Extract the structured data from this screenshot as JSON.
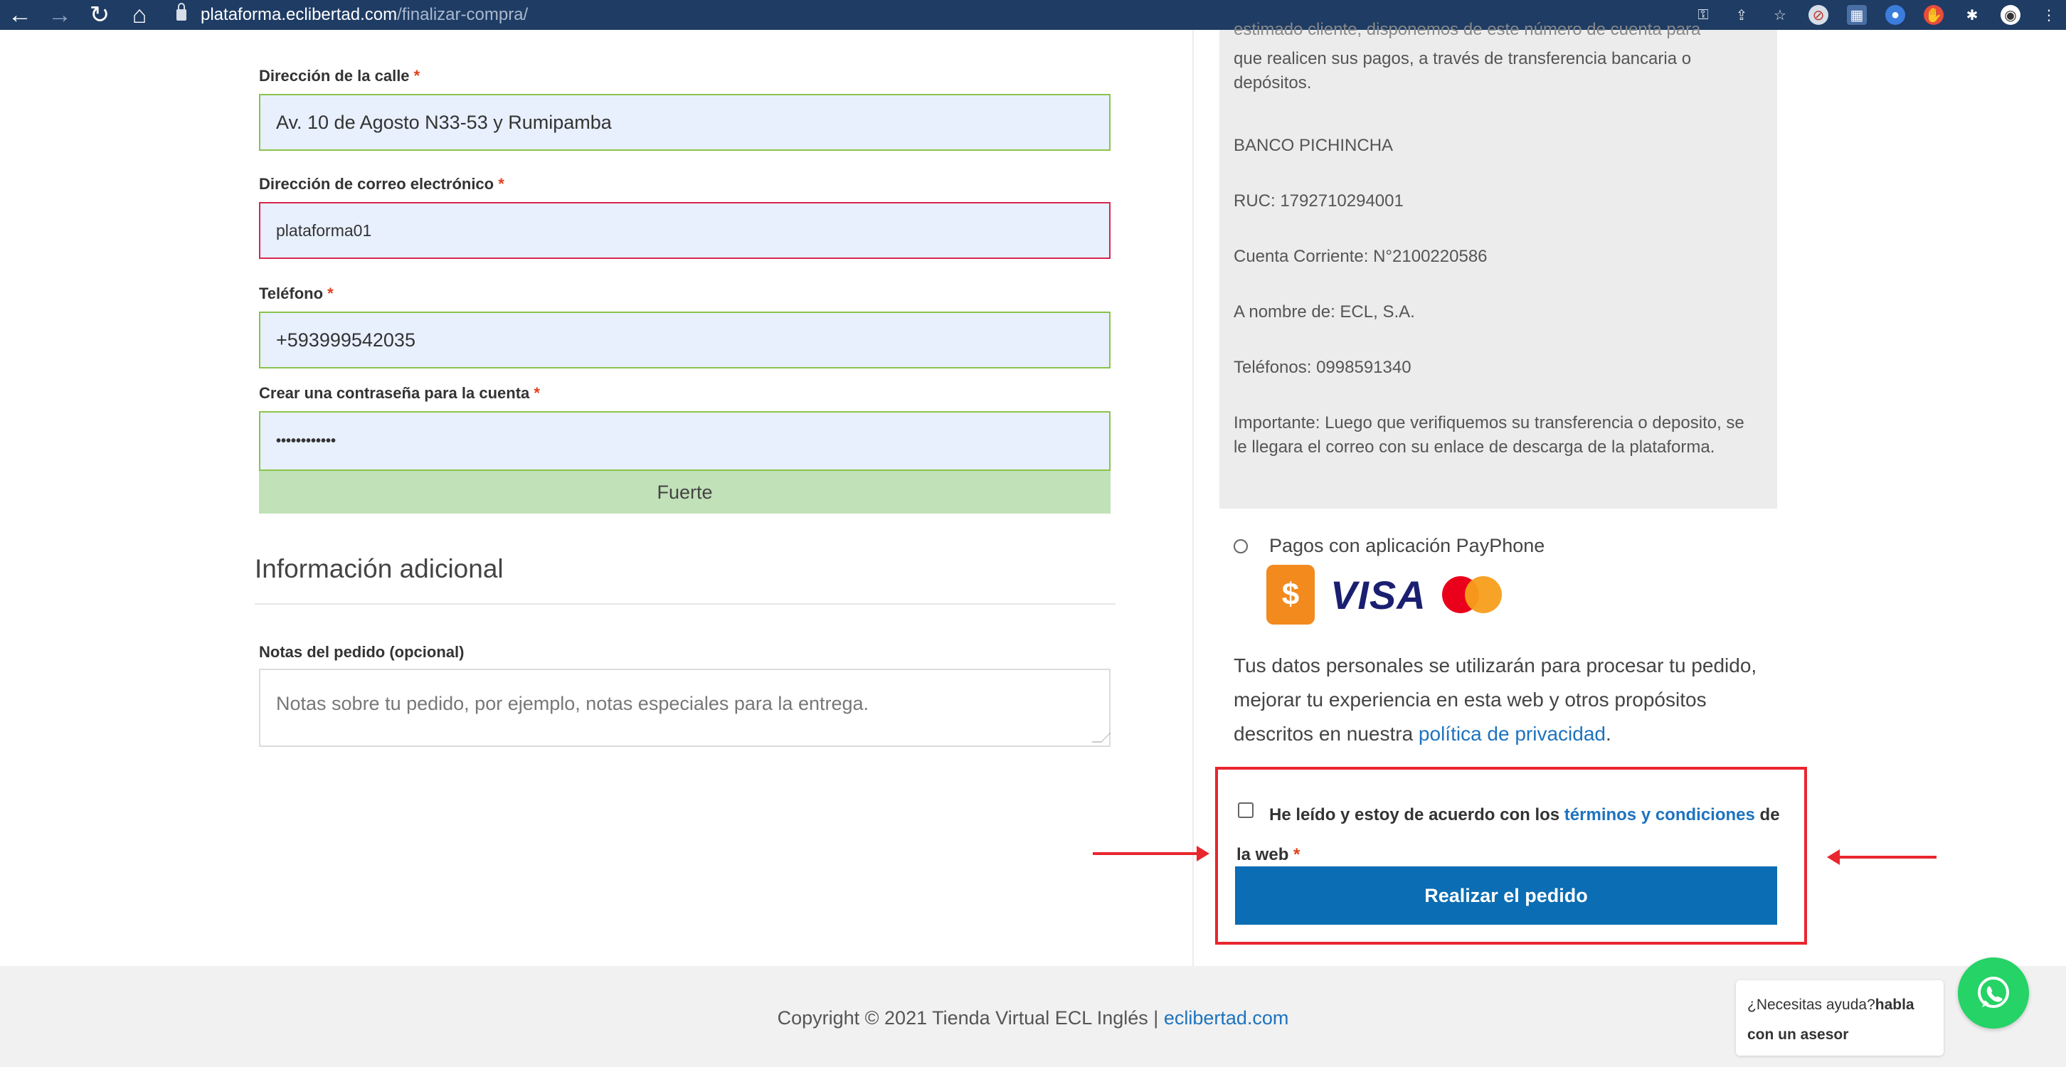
{
  "browser": {
    "url_domain": "plataforma.eclibertad.com",
    "url_path": "/finalizar-compra/"
  },
  "form": {
    "street_label": "Dirección de la calle",
    "street_value": "Av. 10 de Agosto N33-53 y Rumipamba",
    "email_label": "Dirección de correo electrónico",
    "email_value": "plataforma01",
    "phone_label": "Teléfono",
    "phone_value": "+593999542035",
    "password_label": "Crear una contraseña para la cuenta",
    "password_value": "••••••••••••",
    "strength_label": "Fuerte",
    "required_mark": "*"
  },
  "additional": {
    "title": "Información adicional",
    "notes_label": "Notas del pedido (opcional)",
    "notes_placeholder": "Notas sobre tu pedido, por ejemplo, notas especiales para la entrega."
  },
  "payment_box": {
    "cut_line": "estimado cliente, disponemos de este número de cuenta para",
    "line1": "que realicen sus pagos, a través de transferencia bancaria o depósitos.",
    "bank": "BANCO PICHINCHA",
    "ruc": "RUC: 1792710294001",
    "account": "Cuenta Corriente: N°2100220586",
    "name": "A nombre de: ECL, S.A.",
    "phones": "Teléfonos: 0998591340",
    "important": "Importante: Luego que verifiquemos su transferencia o deposito, se le llegara el correo con su enlace de descarga de la plataforma."
  },
  "payphone": {
    "label": "Pagos con aplicación PayPhone",
    "visa": "VISA"
  },
  "privacy": {
    "text": "Tus datos personales se utilizarán para procesar tu pedido, mejorar tu experiencia en esta web y otros propósitos descritos en nuestra ",
    "link": "política de privacidad",
    "end": "."
  },
  "terms": {
    "text": "He leído y estoy de acuerdo con los ",
    "link": "términos y condiciones",
    "text2": " de la web ",
    "required": "*"
  },
  "order_button": "Realizar el pedido",
  "footer": {
    "copyright": "Copyright © 2021 Tienda Virtual ECL Inglés | ",
    "link": "eclibertad.com",
    "help_text": "¿Necesitas ayuda?",
    "help_bold": "habla con un asesor"
  },
  "colors": {
    "browser_bar": "#1f3c64",
    "accent_blue": "#0b6db3",
    "highlight_red": "#e8262e",
    "whatsapp_green": "#25d366"
  }
}
